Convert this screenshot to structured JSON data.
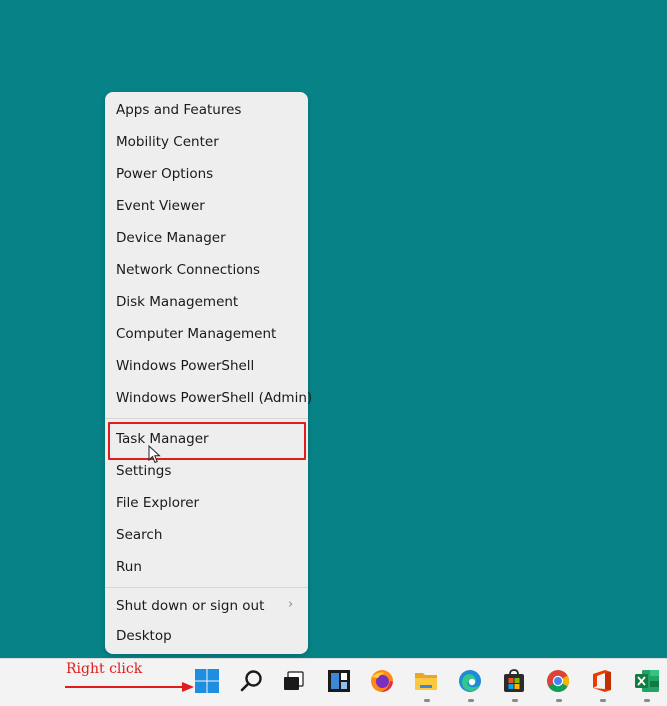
{
  "menu": {
    "items": [
      {
        "label": "Apps and Features"
      },
      {
        "label": "Mobility Center"
      },
      {
        "label": "Power Options"
      },
      {
        "label": "Event Viewer"
      },
      {
        "label": "Device Manager"
      },
      {
        "label": "Network Connections"
      },
      {
        "label": "Disk Management"
      },
      {
        "label": "Computer Management"
      },
      {
        "label": "Windows PowerShell"
      },
      {
        "label": "Windows PowerShell (Admin)"
      },
      {
        "label": "Task Manager"
      },
      {
        "label": "Settings"
      },
      {
        "label": "File Explorer"
      },
      {
        "label": "Search"
      },
      {
        "label": "Run"
      },
      {
        "label": "Shut down or sign out"
      },
      {
        "label": "Desktop"
      }
    ],
    "submenu_chevron": "›"
  },
  "annotation": {
    "label": "Right click",
    "color": "#e01c1c"
  },
  "taskbar": {
    "icons": [
      "windows-start-icon",
      "search-icon",
      "task-view-icon",
      "widgets-icon",
      "firefox-icon",
      "file-explorer-icon",
      "edge-icon",
      "store-icon",
      "chrome-icon",
      "office-icon",
      "excel-icon"
    ]
  },
  "colors": {
    "desktop": "#078387",
    "menu_bg": "#eeeeee",
    "highlight_border": "#e01c1c",
    "taskbar_bg": "#f3f3f3"
  }
}
